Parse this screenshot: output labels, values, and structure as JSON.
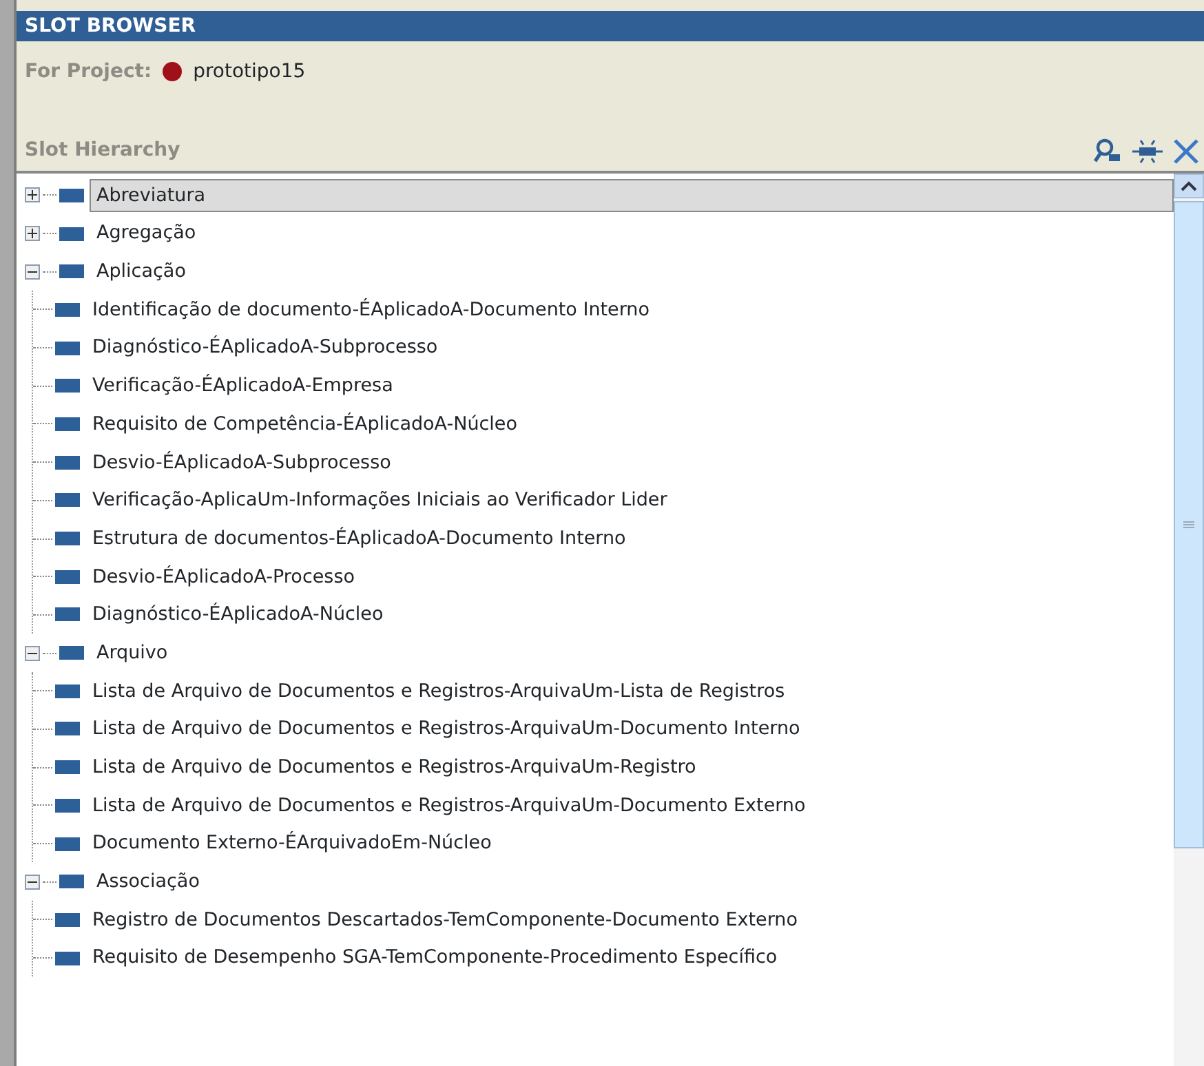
{
  "panel": {
    "title": "SLOT BROWSER",
    "project_label": "For Project:",
    "project_name": "prototipo15",
    "section_title": "Slot Hierarchy"
  },
  "tree": [
    {
      "label": "Abreviatura",
      "selected": true,
      "expanded": false
    },
    {
      "label": "Agregação",
      "selected": false,
      "expanded": false
    },
    {
      "label": "Aplicação",
      "selected": false,
      "expanded": true,
      "children": [
        {
          "label": "Identificação de documento-ÉAplicadoA-Documento Interno",
          "selected": false
        },
        {
          "label": "Diagnóstico-ÉAplicadoA-Subprocesso",
          "selected": false
        },
        {
          "label": "Verificação-ÉAplicadoA-Empresa",
          "selected": false
        },
        {
          "label": "Requisito de Competência-ÉAplicadoA-Núcleo",
          "selected": false
        },
        {
          "label": "Desvio-ÉAplicadoA-Subprocesso",
          "selected": false
        },
        {
          "label": "Verificação-AplicaUm-Informações Iniciais ao Verificador Lider",
          "selected": false
        },
        {
          "label": "Estrutura de documentos-ÉAplicadoA-Documento Interno",
          "selected": false
        },
        {
          "label": "Desvio-ÉAplicadoA-Processo",
          "selected": false
        },
        {
          "label": "Diagnóstico-ÉAplicadoA-Núcleo",
          "selected": false
        }
      ]
    },
    {
      "label": "Arquivo",
      "selected": false,
      "expanded": true,
      "children": [
        {
          "label": "Lista de Arquivo de Documentos e Registros-ArquivaUm-Lista de Registros",
          "selected": false
        },
        {
          "label": "Lista de Arquivo de Documentos e Registros-ArquivaUm-Documento Interno",
          "selected": false
        },
        {
          "label": "Lista de Arquivo de Documentos e Registros-ArquivaUm-Registro",
          "selected": false
        },
        {
          "label": "Lista de Arquivo de Documentos e Registros-ArquivaUm-Documento Externo",
          "selected": false
        },
        {
          "label": "Documento Externo-ÉArquivadoEm-Núcleo",
          "selected": false
        }
      ]
    },
    {
      "label": "Associação",
      "selected": false,
      "expanded": true,
      "children": [
        {
          "label": "Registro de Documentos Descartados-TemComponente-Documento Externo",
          "selected": false
        },
        {
          "label": "Requisito de Desempenho SGA-TemComponente-Procedimento Específico",
          "selected": false
        }
      ]
    }
  ]
}
